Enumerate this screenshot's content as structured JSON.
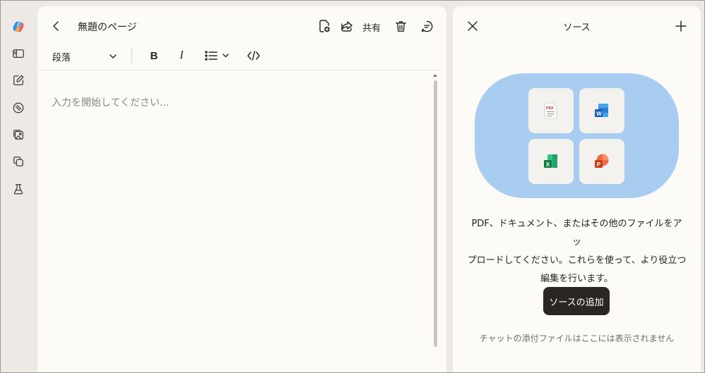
{
  "rail": {
    "items": [
      "copilot-logo-icon",
      "sidebar-toggle-icon",
      "compose-icon",
      "discover-icon",
      "images-icon",
      "pages-icon",
      "labs-icon"
    ]
  },
  "editor": {
    "page_title": "無題のページ",
    "share_label": "共有",
    "toolbar": {
      "paragraph_style": "段落",
      "bold_label": "B",
      "italic_label": "I"
    },
    "placeholder": "入力を開始してください..."
  },
  "sources": {
    "title": "ソース",
    "file_types": [
      "PDF",
      "Word",
      "Excel",
      "PowerPoint"
    ],
    "pdf_badge": "PDF",
    "word_badge": "W",
    "excel_badge": "X",
    "ppt_badge": "P",
    "description_line1": "PDF、ドキュメント、またはその他のファイルをアッ",
    "description_line2": "プロードしてください。これらを使って、より役立つ",
    "description_line3": "編集を行います。",
    "add_button": "ソースの追加",
    "note": "チャットの添付ファイルはここには表示されません"
  },
  "colors": {
    "accent_blue": "#a9cdf1",
    "button_dark": "#2b2623",
    "panel_bg": "#fdfbf8",
    "app_bg": "#edeae6",
    "pdf_red": "#d13438",
    "word_blue": "#185abd",
    "excel_green": "#107c41",
    "ppt_orange": "#c43e1c"
  }
}
